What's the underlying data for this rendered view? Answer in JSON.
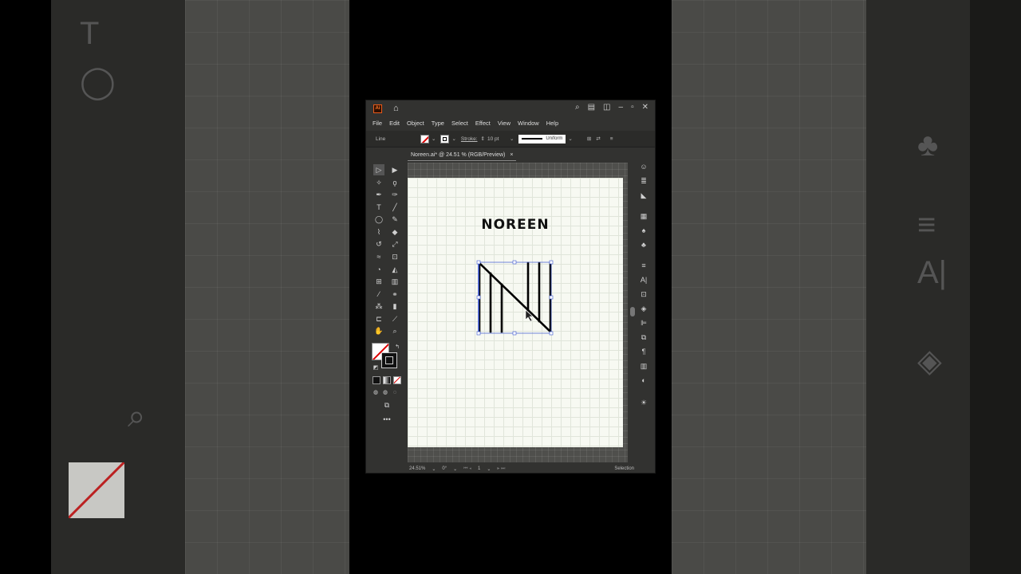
{
  "window": {
    "app_logo": "Ai",
    "menu": [
      "File",
      "Edit",
      "Object",
      "Type",
      "Select",
      "Effect",
      "View",
      "Window",
      "Help"
    ]
  },
  "control_bar": {
    "selection_label": "Line",
    "stroke_label": "Stroke:",
    "stroke_weight": "10 pt",
    "profile": "Uniform"
  },
  "document": {
    "tab_title": "Noreen.ai* @ 24.51 % (RGB/Preview)",
    "close_glyph": "×"
  },
  "artwork": {
    "title": "NOREEN"
  },
  "status": {
    "zoom": "24.51%",
    "rotation": "0°",
    "artboard": "1",
    "tool": "Selection"
  },
  "colors": {
    "ui_dark": "#323230",
    "artboard": "#f7f9f2",
    "selection": "#3a55d0",
    "ai_orange": "#ff7c2c"
  }
}
